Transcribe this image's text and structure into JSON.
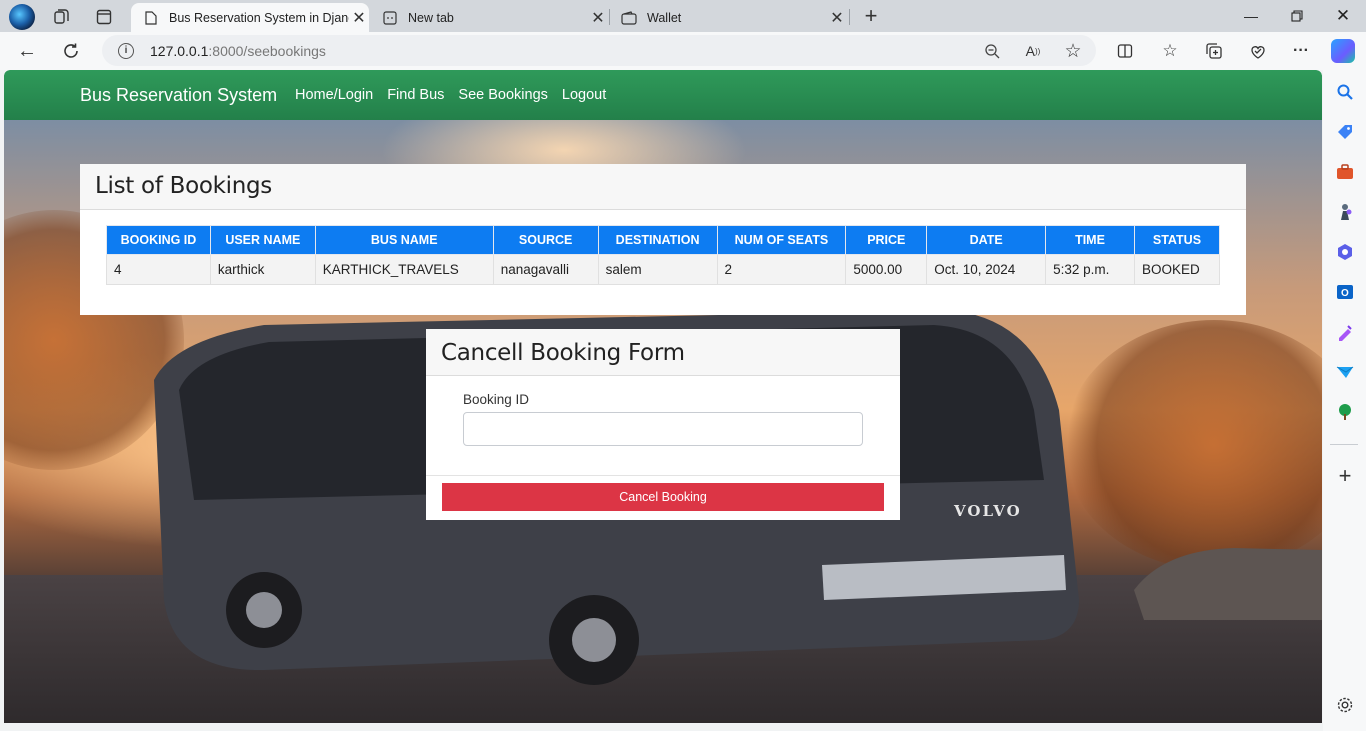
{
  "browser": {
    "tabs": [
      {
        "title": "Bus Reservation System in Djang",
        "active": true
      },
      {
        "title": "New tab",
        "active": false
      },
      {
        "title": "Wallet",
        "active": false
      }
    ],
    "url_host": "127.0.0.1",
    "url_path": ":8000/seebookings",
    "accent": "#0d7cf2"
  },
  "navbar": {
    "brand": "Bus Reservation System",
    "links": [
      "Home/Login",
      "Find Bus",
      "See Bookings",
      "Logout"
    ],
    "color": "#23804a"
  },
  "bookings": {
    "title": "List of Bookings",
    "columns": [
      "BOOKING ID",
      "USER NAME",
      "BUS NAME",
      "SOURCE",
      "DESTINATION",
      "NUM OF SEATS",
      "PRICE",
      "DATE",
      "TIME",
      "STATUS"
    ],
    "rows": [
      [
        "4",
        "karthick",
        "KARTHICK_TRAVELS",
        "nanagavalli",
        "salem",
        "2",
        "5000.00",
        "Oct. 10, 2024",
        "5:32 p.m.",
        "BOOKED"
      ]
    ]
  },
  "cancel_form": {
    "title": "Cancell Booking Form",
    "field_label": "Booking ID",
    "field_value": "",
    "button_label": "Cancel Booking",
    "button_color": "#dc3545"
  },
  "hero": {
    "bus_badge": "VOLVO"
  }
}
